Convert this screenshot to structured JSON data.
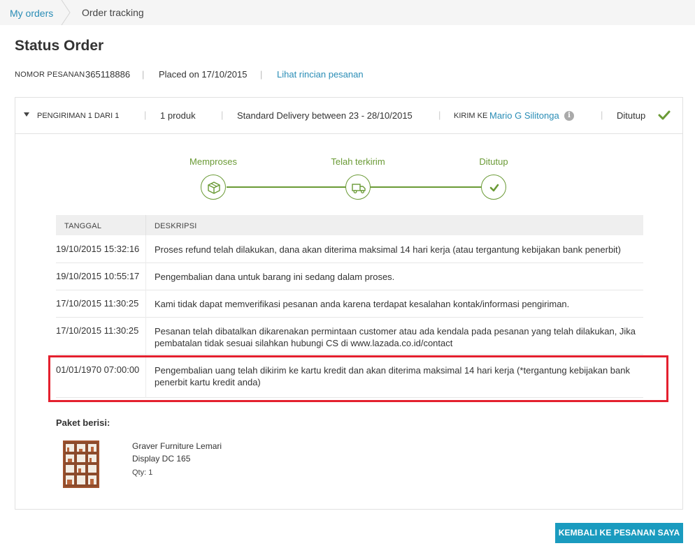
{
  "breadcrumb": {
    "link": "My orders",
    "current": "Order tracking"
  },
  "page_title": "Status Order",
  "order": {
    "number_label": "NOMOR PESANAN",
    "number": "365118886",
    "placed": "Placed on 17/10/2015",
    "details_link": "Lihat rincian pesanan"
  },
  "shipment": {
    "label": "PENGIRIMAN 1 DARI 1",
    "products": "1 produk",
    "delivery": "Standard Delivery between 23 - 28/10/2015",
    "ship_to_label": "KIRIM KE",
    "recipient": "Mario G Silitonga",
    "status": "Ditutup",
    "status_color": "#6a9a35"
  },
  "steps": [
    {
      "label": "Memproses",
      "icon": "box-icon"
    },
    {
      "label": "Telah terkirim",
      "icon": "truck-icon"
    },
    {
      "label": "Ditutup",
      "icon": "check-icon"
    }
  ],
  "table": {
    "headers": {
      "date": "TANGGAL",
      "desc": "DESKRIPSI"
    },
    "rows": [
      {
        "date": "19/10/2015 15:32:16",
        "desc": "Proses refund telah dilakukan, dana akan diterima maksimal 14 hari kerja (atau tergantung kebijakan bank penerbit)"
      },
      {
        "date": "19/10/2015 10:55:17",
        "desc": "Pengembalian dana untuk barang ini sedang dalam proses."
      },
      {
        "date": "17/10/2015 11:30:25",
        "desc": "Kami tidak dapat memverifikasi pesanan anda karena terdapat kesalahan kontak/informasi pengiriman."
      },
      {
        "date": "17/10/2015 11:30:25",
        "desc": "Pesanan telah dibatalkan dikarenakan permintaan customer atau ada kendala pada pesanan yang telah dilakukan, Jika pembatalan tidak sesuai silahkan hubungi CS di www.lazada.co.id/contact"
      },
      {
        "date": "01/01/1970 07:00:00",
        "desc": "Pengembalian uang telah dikirim ke kartu kredit dan akan diterima maksimal 14 hari kerja (*tergantung kebijakan bank penerbit kartu kredit anda)"
      }
    ]
  },
  "package": {
    "title": "Paket berisi:",
    "item_name": "Graver Furniture Lemari Display DC 165",
    "qty": "Qty: 1"
  },
  "back_button": "KEMBALI KE PESANAN SAYA",
  "colors": {
    "accent": "#2a8db6",
    "green": "#6a9a35",
    "button": "#1a9bbf",
    "highlight": "#e4202e"
  }
}
